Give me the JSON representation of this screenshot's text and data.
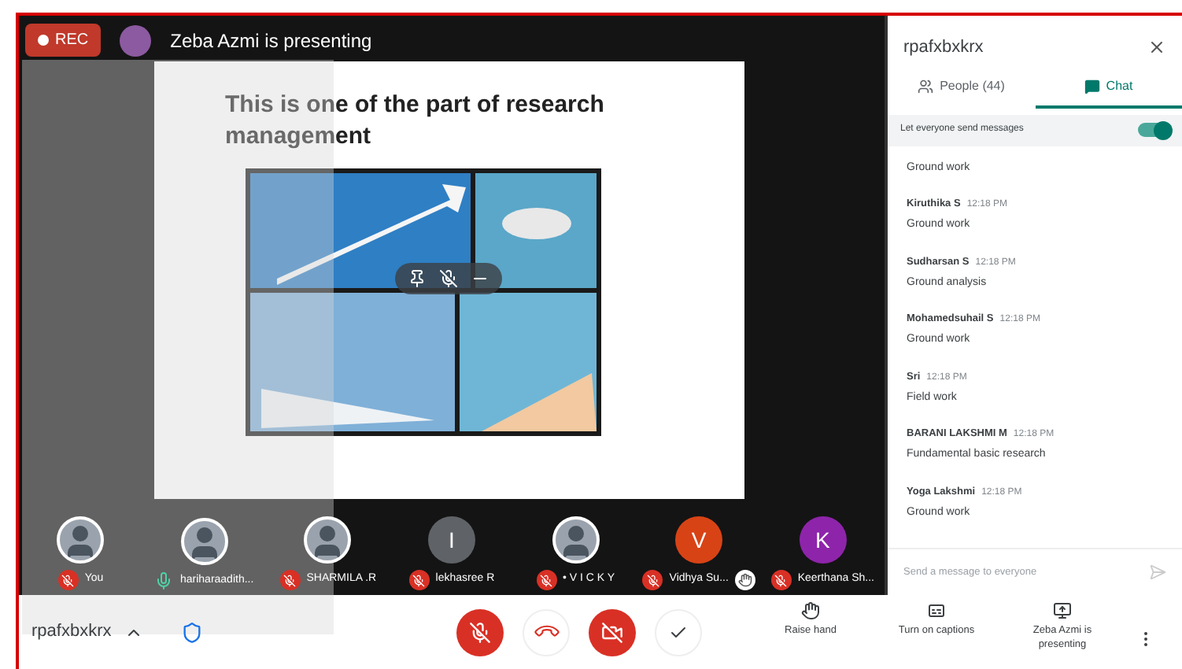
{
  "recording": {
    "label": "REC"
  },
  "presenter_banner": {
    "text": "Zeba Azmi is presenting"
  },
  "slide": {
    "title": "This is one of the part of research management"
  },
  "participants": [
    {
      "name": "You",
      "kind": "photo",
      "muted": true
    },
    {
      "name": "hariharaadith...",
      "kind": "photo",
      "muted": false
    },
    {
      "name": "SHARMILA .R",
      "kind": "photo",
      "muted": true
    },
    {
      "name": "lekhasree R",
      "kind": "letter",
      "letter": "I",
      "color": "#5f6368",
      "muted": true
    },
    {
      "name": "• V I C K Y",
      "kind": "photo",
      "muted": true
    },
    {
      "name": "Vidhya Su...",
      "kind": "letter",
      "letter": "V",
      "color": "#d84315",
      "muted": true,
      "hand_raised": true
    },
    {
      "name": "Keerthana Sh...",
      "kind": "letter",
      "letter": "K",
      "color": "#8e24aa",
      "muted": true
    }
  ],
  "meeting": {
    "code": "rpafxbxkrx"
  },
  "controls": {
    "mic_on": false,
    "camera_on": false
  },
  "actions": [
    {
      "kind": "hand",
      "label": "Raise hand"
    },
    {
      "kind": "captions",
      "label": "Turn on captions"
    },
    {
      "kind": "present",
      "label": "Zeba Azmi is presenting"
    }
  ],
  "panel": {
    "title": "rpafxbxkrx",
    "tabs": [
      {
        "kind": "people",
        "label": "People (44)",
        "selected": false
      },
      {
        "kind": "chat",
        "label": "Chat",
        "selected": true
      }
    ],
    "setting": {
      "label": "Let everyone send messages",
      "on": true
    },
    "messages": [
      {
        "text": "Ground work"
      },
      {
        "sender": "Kiruthika S",
        "time": "12:18 PM",
        "text": "Ground work"
      },
      {
        "sender": "Sudharsan S",
        "time": "12:18 PM",
        "text": "Ground analysis"
      },
      {
        "sender": "Mohamedsuhail S",
        "time": "12:18 PM",
        "text": "Ground work"
      },
      {
        "sender": "Sri",
        "time": "12:18 PM",
        "text": "Field work"
      },
      {
        "sender": "BARANI LAKSHMI M",
        "time": "12:18 PM",
        "text": "Fundamental basic research"
      },
      {
        "sender": "Yoga Lakshmi",
        "time": "12:18 PM",
        "text": "Ground work"
      }
    ],
    "input": {
      "placeholder": "Send a message to everyone"
    }
  }
}
